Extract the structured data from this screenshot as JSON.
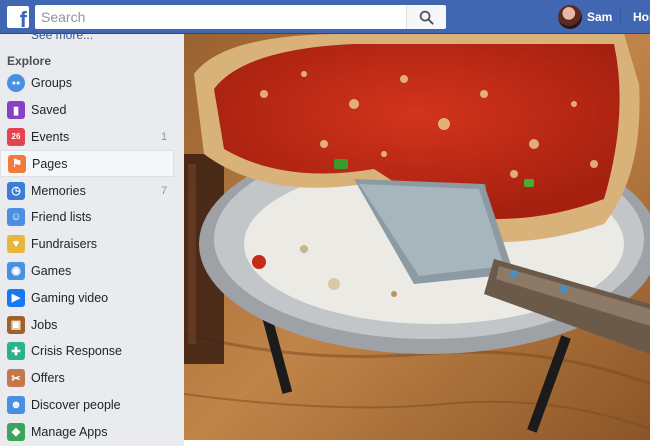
{
  "header": {
    "logo_letter": "f",
    "search_placeholder": "Search",
    "user_name": "Sam",
    "home_label": "Hom"
  },
  "sidebar": {
    "see_more": "See more...",
    "section_title": "Explore",
    "items": [
      {
        "label": "Groups",
        "icon": "groups-icon",
        "color": "#4a90e2"
      },
      {
        "label": "Saved",
        "icon": "saved-icon",
        "color": "#8b3fc4"
      },
      {
        "label": "Events",
        "icon": "events-icon",
        "color": "#e4454c",
        "count": "1"
      },
      {
        "label": "Pages",
        "icon": "pages-icon",
        "color": "#f27a3a",
        "active": true
      },
      {
        "label": "Memories",
        "icon": "memories-icon",
        "color": "#3b7cd6",
        "count": "7"
      },
      {
        "label": "Friend lists",
        "icon": "friend-lists-icon",
        "color": "#4a90e2"
      },
      {
        "label": "Fundraisers",
        "icon": "fundraisers-icon",
        "color": "#e8b43a"
      },
      {
        "label": "Games",
        "icon": "games-icon",
        "color": "#4a90e2"
      },
      {
        "label": "Gaming video",
        "icon": "gaming-video-icon",
        "color": "#1877f2"
      },
      {
        "label": "Jobs",
        "icon": "jobs-icon",
        "color": "#a0622d"
      },
      {
        "label": "Crisis Response",
        "icon": "crisis-response-icon",
        "color": "#2bb28d"
      },
      {
        "label": "Offers",
        "icon": "offers-icon",
        "color": "#c2784a"
      },
      {
        "label": "Discover people",
        "icon": "discover-people-icon",
        "color": "#4a90e2"
      },
      {
        "label": "Manage Apps",
        "icon": "manage-apps-icon",
        "color": "#3aa55a"
      }
    ]
  },
  "colors": {
    "brand_blue": "#4267b2",
    "link_blue": "#365899",
    "sidebar_bg": "#e9ebee"
  }
}
